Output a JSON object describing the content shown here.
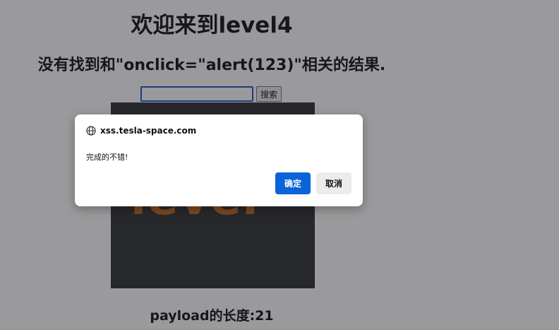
{
  "page": {
    "title": "欢迎来到level4",
    "result_message": "没有找到和\"onclick=\"alert(123)\"相关的结果.",
    "search": {
      "value": "",
      "button_label": "搜索"
    },
    "image": {
      "text": "level"
    },
    "payload_length": "payload的长度:21"
  },
  "dialog": {
    "origin": "xss.tesla-space.com",
    "message": "完成的不错!",
    "ok_label": "确定",
    "cancel_label": "取消"
  },
  "colors": {
    "overlay": "#9a9a9c",
    "ok_button": "#0b63d9",
    "image_bg": "#2f3034",
    "image_text": "#c8691e"
  }
}
